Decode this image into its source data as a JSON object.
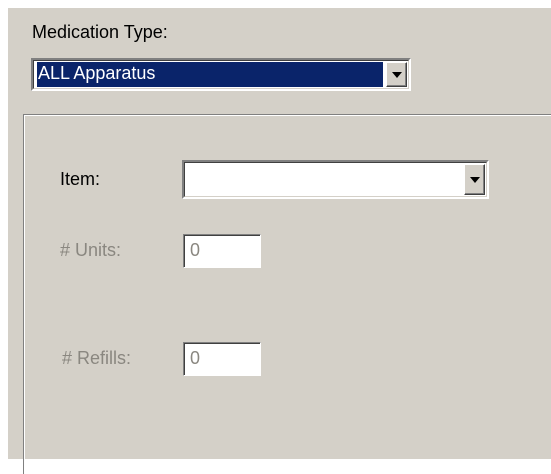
{
  "medication_type": {
    "label": "Medication Type:",
    "selected_value": "ALL Apparatus"
  },
  "form": {
    "item": {
      "label": "Item:",
      "value": ""
    },
    "units": {
      "label": "# Units:",
      "value": "0"
    },
    "refills": {
      "label": "# Refills:",
      "value": "0"
    }
  },
  "icons": {
    "dropdown": "chevron-down-icon"
  }
}
